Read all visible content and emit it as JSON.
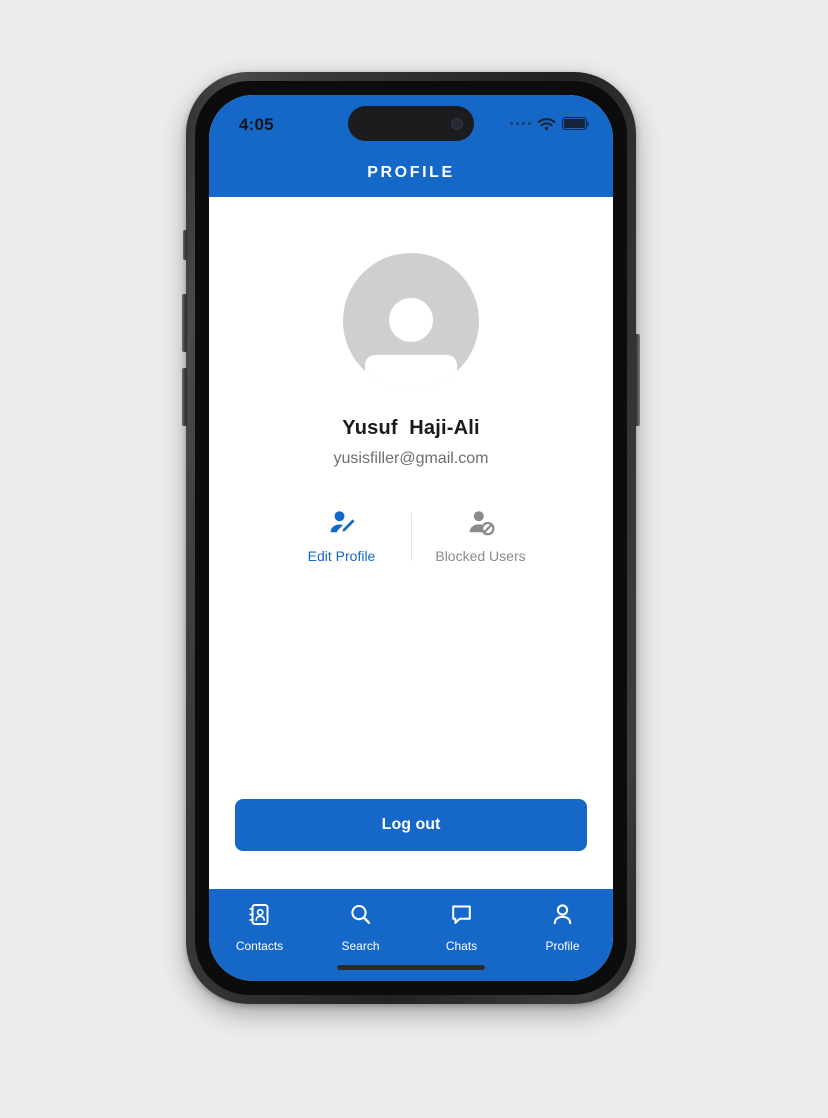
{
  "theme": {
    "brand_blue": "#1668c8",
    "muted_gray": "#8a8a8a",
    "avatar_gray": "#cfcfcf",
    "screen_bg": "#ffffff"
  },
  "status_bar": {
    "time": "4:05",
    "signal_icon": "signal-dots-icon",
    "wifi_icon": "wifi-icon",
    "battery_icon": "battery-icon"
  },
  "header": {
    "title": "PROFILE"
  },
  "profile": {
    "avatar_icon": "default-avatar-icon",
    "name": "Yusuf  Haji-Ali",
    "email": "yusisfiller@gmail.com"
  },
  "actions": [
    {
      "label": "Edit Profile",
      "icon": "person-edit-icon"
    },
    {
      "label": "Blocked Users",
      "icon": "person-blocked-icon"
    }
  ],
  "logout": {
    "label": "Log out"
  },
  "bottom_nav": {
    "items": [
      {
        "label": "Contacts",
        "icon": "contacts-book-icon",
        "active": false
      },
      {
        "label": "Search",
        "icon": "search-icon",
        "active": false
      },
      {
        "label": "Chats",
        "icon": "chat-bubble-icon",
        "active": false
      },
      {
        "label": "Profile",
        "icon": "person-icon",
        "active": true
      }
    ]
  }
}
